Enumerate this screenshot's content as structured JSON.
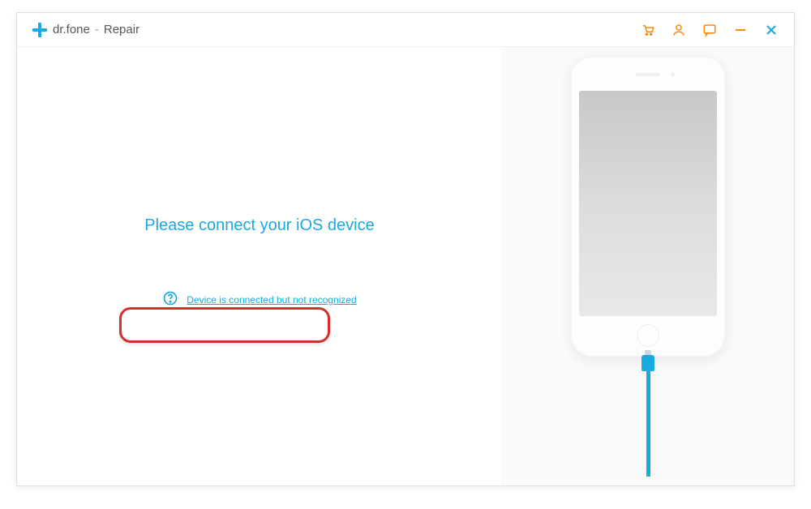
{
  "titlebar": {
    "brand": "dr.fone",
    "separator": "-",
    "section": "Repair"
  },
  "icons": {
    "cart": "cart-icon",
    "account": "account-icon",
    "chat": "chat-icon",
    "minimize": "minimize-icon",
    "close": "close-icon",
    "logo": "logo-icon",
    "help": "help-icon"
  },
  "main": {
    "message": "Please connect your iOS device",
    "help_link": "Device is connected but not recognized"
  },
  "colors": {
    "accent": "#1aa9e0",
    "accent_orange": "#ff8a00",
    "annotation_red": "#d62e2e"
  }
}
